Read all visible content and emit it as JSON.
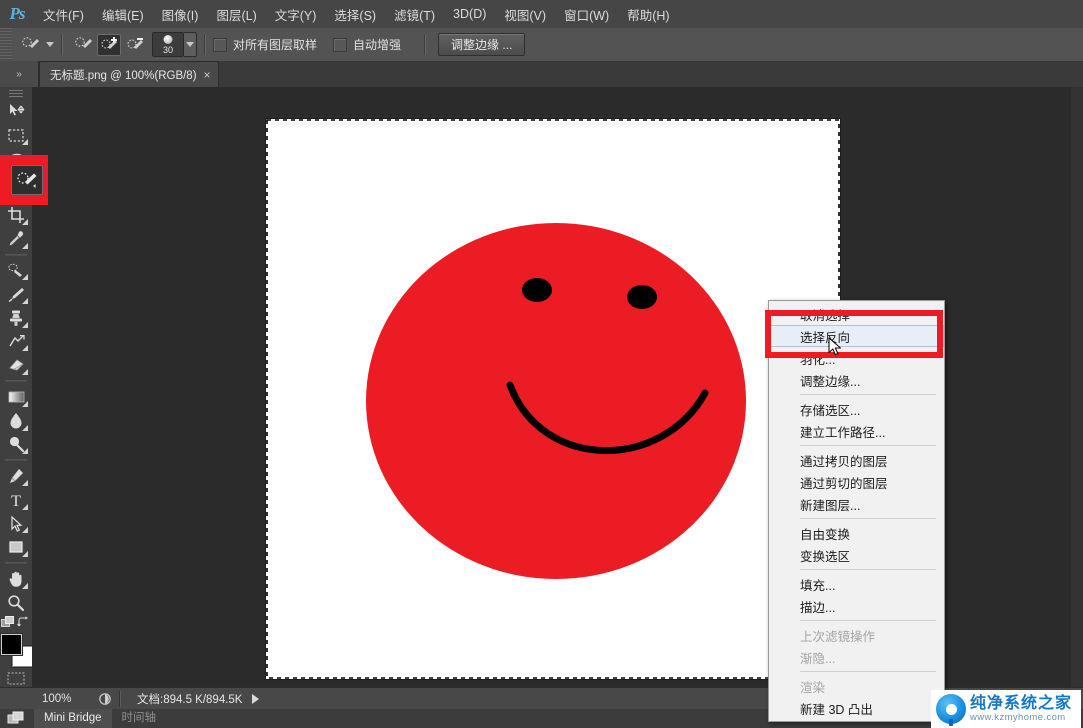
{
  "app": {
    "logo": "ps-logo",
    "menus": [
      {
        "label": "文件(F)"
      },
      {
        "label": "编辑(E)"
      },
      {
        "label": "图像(I)"
      },
      {
        "label": "图层(L)"
      },
      {
        "label": "文字(Y)"
      },
      {
        "label": "选择(S)"
      },
      {
        "label": "滤镜(T)"
      },
      {
        "label": "3D(D)"
      },
      {
        "label": "视图(V)"
      },
      {
        "label": "窗口(W)"
      },
      {
        "label": "帮助(H)"
      }
    ]
  },
  "options_bar": {
    "tool_preset_icon": "quick-selection-tool-icon",
    "modes": [
      {
        "name": "new-selection",
        "active": false
      },
      {
        "name": "add-to-selection",
        "active": true
      },
      {
        "name": "subtract-from-selection",
        "active": false
      }
    ],
    "brush_size": "30",
    "sample_all_layers_label": "对所有图层取样",
    "sample_all_layers_checked": false,
    "auto_enhance_label": "自动增强",
    "auto_enhance_checked": false,
    "refine_edge_label": "调整边缘 ..."
  },
  "tabs": {
    "document_title": "无标题.png @ 100%(RGB/8)",
    "close_glyph": "×"
  },
  "tools": [
    {
      "name": "move-tool",
      "label": "移动工具"
    },
    {
      "name": "rectangular-marquee-tool",
      "label": "矩形选框工具"
    },
    {
      "name": "lasso-tool",
      "label": "套索工具"
    },
    {
      "name": "quick-selection-tool",
      "label": "快速选择工具",
      "selected": true
    },
    {
      "name": "crop-tool",
      "label": "裁剪工具"
    },
    {
      "name": "eyedropper-tool",
      "label": "吸管工具"
    },
    {
      "name": "spot-healing-brush-tool",
      "label": "污点修复画笔工具"
    },
    {
      "name": "brush-tool",
      "label": "画笔工具"
    },
    {
      "name": "clone-stamp-tool",
      "label": "仿制图章工具"
    },
    {
      "name": "history-brush-tool",
      "label": "历史记录画笔工具"
    },
    {
      "name": "eraser-tool",
      "label": "橡皮擦工具"
    },
    {
      "name": "gradient-tool",
      "label": "渐变工具"
    },
    {
      "name": "blur-tool",
      "label": "模糊工具"
    },
    {
      "name": "dodge-tool",
      "label": "减淡工具"
    },
    {
      "name": "pen-tool",
      "label": "钢笔工具"
    },
    {
      "name": "type-tool",
      "label": "横排文字工具"
    },
    {
      "name": "path-selection-tool",
      "label": "路径选择工具"
    },
    {
      "name": "rectangle-tool",
      "label": "矩形工具"
    },
    {
      "name": "hand-tool",
      "label": "抓手工具"
    },
    {
      "name": "zoom-tool",
      "label": "缩放工具"
    }
  ],
  "color_swatches": {
    "foreground": "#000000",
    "background": "#ffffff"
  },
  "context_menu": {
    "items": [
      {
        "label": "取消选择",
        "disabled": false,
        "selected": false,
        "obscured": true
      },
      {
        "label": "选择反向",
        "disabled": false,
        "selected": true
      },
      {
        "label": "羽化...",
        "disabled": false,
        "obscured": true
      },
      {
        "label": "调整边缘...",
        "disabled": false
      },
      {
        "divider": true
      },
      {
        "label": "存储选区...",
        "disabled": false
      },
      {
        "label": "建立工作路径...",
        "disabled": false
      },
      {
        "divider": true
      },
      {
        "label": "通过拷贝的图层",
        "disabled": false
      },
      {
        "label": "通过剪切的图层",
        "disabled": false
      },
      {
        "label": "新建图层...",
        "disabled": false
      },
      {
        "divider": true
      },
      {
        "label": "自由变换",
        "disabled": false
      },
      {
        "label": "变换选区",
        "disabled": false
      },
      {
        "divider": true
      },
      {
        "label": "填充...",
        "disabled": false
      },
      {
        "label": "描边...",
        "disabled": false
      },
      {
        "divider": true
      },
      {
        "label": "上次滤镜操作",
        "disabled": true
      },
      {
        "label": "渐隐...",
        "disabled": true
      },
      {
        "divider": true
      },
      {
        "label": "渲染",
        "disabled": true
      },
      {
        "label": "新建 3D 凸出",
        "disabled": false
      }
    ]
  },
  "status_bar": {
    "zoom_level": "100%",
    "doc_info": "文档:894.5 K/894.5K",
    "arrow_icon": "triangle-right-icon"
  },
  "bottom_dock": {
    "tabs": [
      {
        "label": "Mini Bridge",
        "active": true
      },
      {
        "label": "时间轴",
        "active": false
      }
    ]
  },
  "canvas": {
    "selection_active": true,
    "background_color": "#ffffff",
    "face_color": "#ec1c24",
    "feature_color": "#000000"
  },
  "watermark": {
    "title": "纯净系统之家",
    "url": "www.kzmyhome.com"
  },
  "highlights": {
    "tool_color": "#ee1b24",
    "menu_color": "#ee1b24"
  }
}
